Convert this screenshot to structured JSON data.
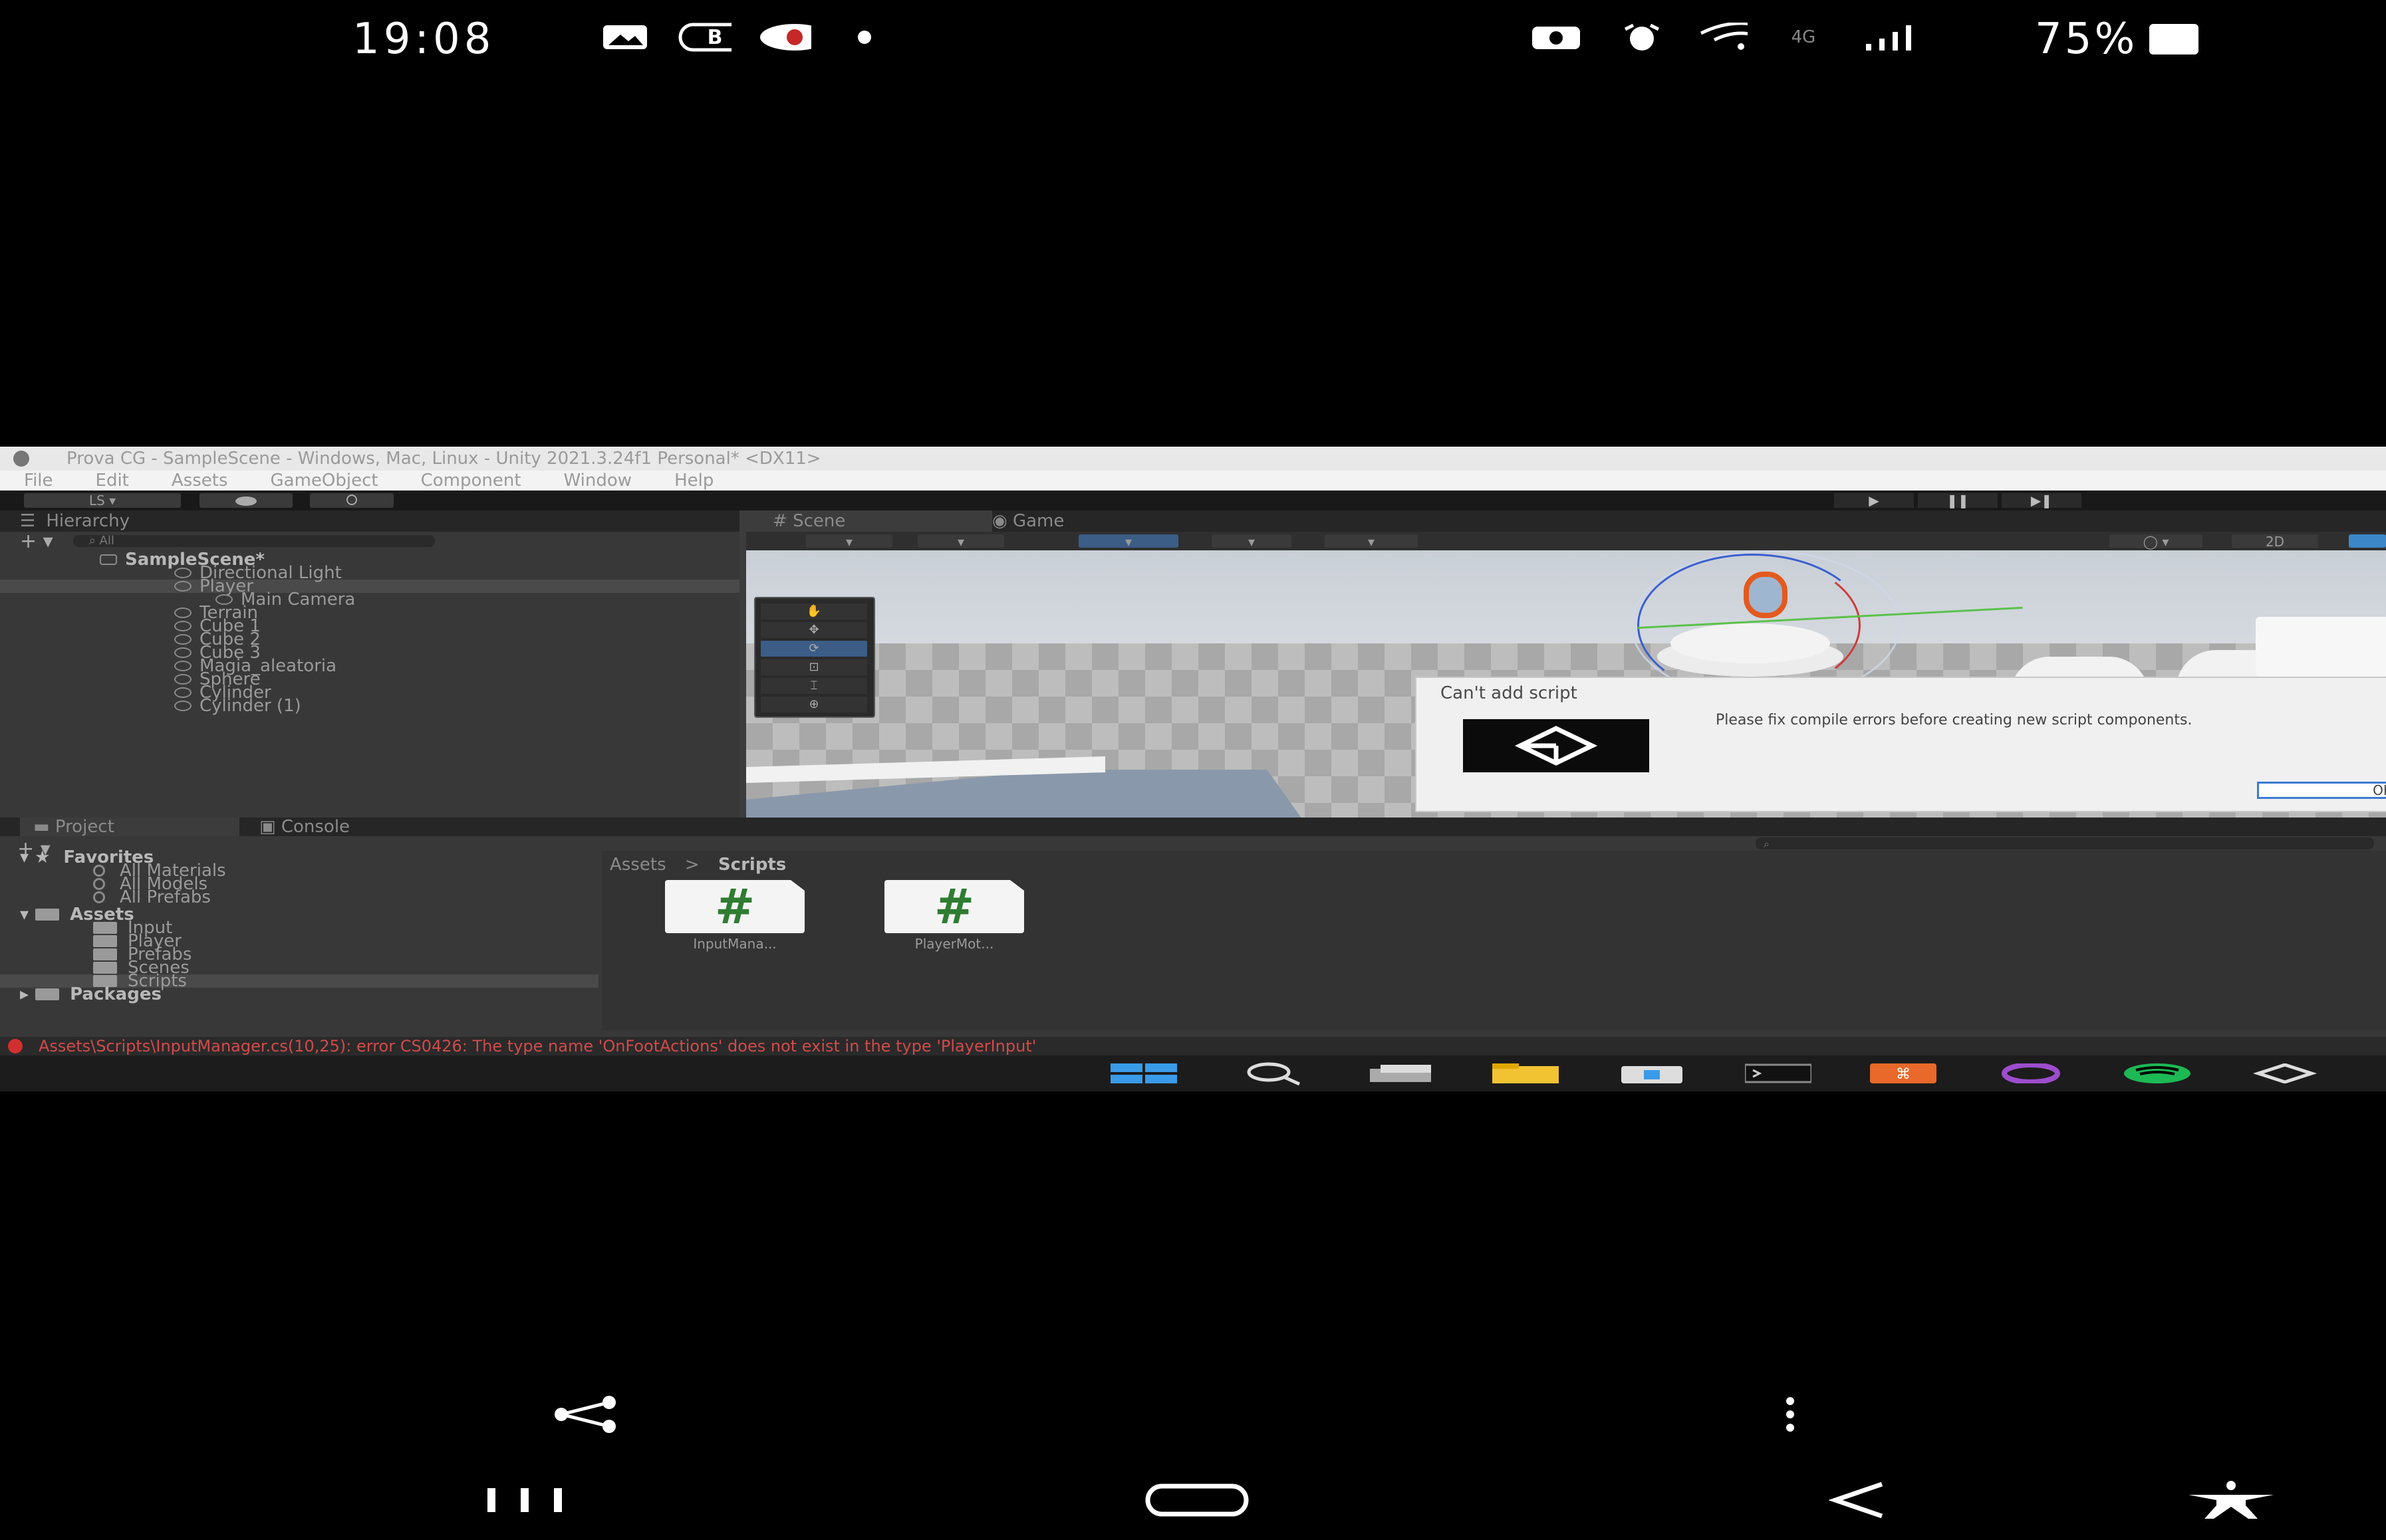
{
  "status_bar": {
    "time": "19:08",
    "left_icons": [
      "gallery-icon",
      "b-circle-icon",
      "game-app-icon",
      "dot-icon"
    ],
    "right_icons": [
      "camera-settings-icon",
      "alarm-icon",
      "wifi-icon",
      "signal-icon"
    ],
    "network": "4G",
    "battery": "75%"
  },
  "unity": {
    "title": "Prova CG - SampleScene - Windows, Mac, Linux - Unity 2021.3.24f1 Personal* <DX11>",
    "menu": [
      "File",
      "Edit",
      "Assets",
      "GameObject",
      "Component",
      "Window",
      "Help"
    ],
    "toolbar": {
      "account": "LS",
      "cloud": "cloud",
      "collab": "collab"
    },
    "hierarchy": {
      "tab": "Hierarchy",
      "search_placeholder": "All",
      "scene": "SampleScene*",
      "items": [
        {
          "label": "Directional Light",
          "depth": 1
        },
        {
          "label": "Player",
          "depth": 1
        },
        {
          "label": "Main Camera",
          "depth": 2
        },
        {
          "label": "Terrain",
          "depth": 1
        },
        {
          "label": "Cube 1",
          "depth": 1
        },
        {
          "label": "Cube 2",
          "depth": 1
        },
        {
          "label": "Cube 3",
          "depth": 1
        },
        {
          "label": "Magia_aleatoria",
          "depth": 1
        },
        {
          "label": "Sphere",
          "depth": 1
        },
        {
          "label": "Cylinder",
          "depth": 1
        },
        {
          "label": "Cylinder (1)",
          "depth": 1
        }
      ]
    },
    "scene_tabs": [
      "Scene",
      "Game"
    ],
    "scene_toolbar": {
      "mode_2d": "2D"
    },
    "dialog": {
      "title": "Can't add script",
      "message": "Please fix compile errors before creating new script components.",
      "ok": "OK"
    },
    "project": {
      "tabs": [
        "Project",
        "Console"
      ],
      "favorites_label": "Favorites",
      "favorites": [
        "All Materials",
        "All Models",
        "All Prefabs"
      ],
      "assets_label": "Assets",
      "asset_folders": [
        "Input",
        "Player",
        "Prefabs",
        "Scenes",
        "Scripts"
      ],
      "packages_label": "Packages",
      "breadcrumb": [
        "Assets",
        "Scripts"
      ],
      "files": [
        {
          "name": "InputMana...",
          "icon": "#"
        },
        {
          "name": "PlayerMot...",
          "icon": "#"
        }
      ]
    },
    "error": "Assets\\Scripts\\InputManager.cs(10,25): error CS0426: The type name 'OnFootActions' does not exist in the type 'PlayerInput'"
  },
  "taskbar": {
    "icons": [
      "windows-start-icon",
      "search-icon",
      "task-view-icon",
      "file-explorer-icon",
      "store-icon",
      "terminal-icon",
      "app-orange-icon",
      "app-purple-icon",
      "spotify-icon",
      "unity-icon"
    ]
  },
  "android": {
    "share_icon": "share-icon",
    "more_icon": "more-vertical-icon",
    "nav": [
      "recents-icon",
      "home-icon",
      "back-icon",
      "accessibility-icon"
    ]
  }
}
